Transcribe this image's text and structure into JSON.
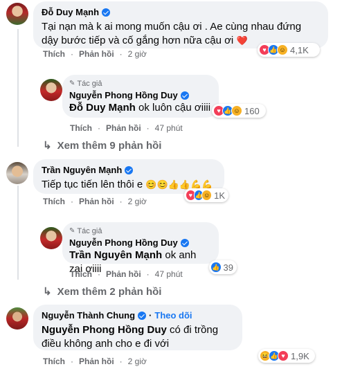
{
  "comments": [
    {
      "name": "Đỗ Duy Mạnh",
      "text": "Tại nạn mà k ai mong muốn cậu ơi . Ae cùng nhau đứng dậy bước tiếp và cố gắng hơn nữa cậu ơi",
      "text_emoji": "❤️",
      "like_label": "Thích",
      "reply_label": "Phản hồi",
      "time": "2 giờ",
      "reaction_count": "4,1K",
      "reply": {
        "author_tag": "Tác giả",
        "name": "Nguyễn Phong Hồng Duy",
        "mention": "Đỗ Duy Mạnh",
        "text": " ok luôn cậu ơiiii",
        "like_label": "Thích",
        "reply_label": "Phản hồi",
        "time": "47 phút",
        "reaction_count": "160"
      },
      "more_replies": "Xem thêm 9 phản hồi"
    },
    {
      "name": "Trần Nguyên Mạnh",
      "text": "Tiếp tục tiến lên thôi e",
      "text_emoji": "😊😊👍👍💪💪",
      "like_label": "Thích",
      "reply_label": "Phản hồi",
      "time": "2 giờ",
      "reaction_count": "1K",
      "reply": {
        "author_tag": "Tác giả",
        "name": "Nguyễn Phong Hồng Duy",
        "mention": "Trần Nguyên Mạnh",
        "text": " ok anh zai ơiiii",
        "like_label": "Thích",
        "reply_label": "Phản hồi",
        "time": "47 phút",
        "reaction_count": "39"
      },
      "more_replies": "Xem thêm 2 phản hồi"
    },
    {
      "name": "Nguyễn Thành Chung",
      "follow_label": "Theo dõi",
      "mention": "Nguyễn Phong Hồng Duy",
      "text": " có đi trồng điều không anh cho e đi với",
      "like_label": "Thích",
      "reply_label": "Phản hồi",
      "time": "2 giờ",
      "reaction_count": "1,9K"
    }
  ],
  "colors": {
    "bubble": "#f0f2f5",
    "meta": "#65676b",
    "link": "#1877f2",
    "love": "#f33e58",
    "like": "#1877f2",
    "haha": "#f7b125"
  },
  "icons": {
    "verified": "verified-badge-icon",
    "author": "pencil-icon",
    "more": "reply-arrow-icon"
  }
}
